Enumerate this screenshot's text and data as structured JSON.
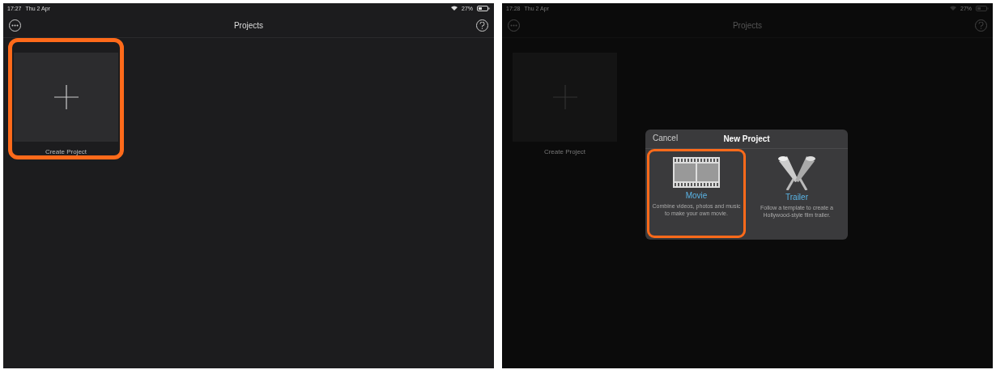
{
  "screens": [
    {
      "dimmed": false,
      "status_bar": {
        "time": "17:27",
        "date": "Thu 2 Apr",
        "battery": "27%"
      },
      "nav": {
        "title": "Projects"
      },
      "tiles": [
        {
          "label": "Create Project",
          "highlighted": true
        }
      ]
    },
    {
      "dimmed": true,
      "status_bar": {
        "time": "17:28",
        "date": "Thu 2 Apr",
        "battery": "27%"
      },
      "nav": {
        "title": "Projects"
      },
      "tiles": [
        {
          "label": "Create Project",
          "highlighted": false
        }
      ],
      "dialog": {
        "cancel": "Cancel",
        "title": "New Project",
        "options": [
          {
            "kind": "movie",
            "title": "Movie",
            "description": "Combine videos, photos and music to make your own movie.",
            "highlighted": true
          },
          {
            "kind": "trailer",
            "title": "Trailer",
            "description": "Follow a template to create a Hollywood-style film trailer.",
            "highlighted": false
          }
        ]
      }
    }
  ]
}
